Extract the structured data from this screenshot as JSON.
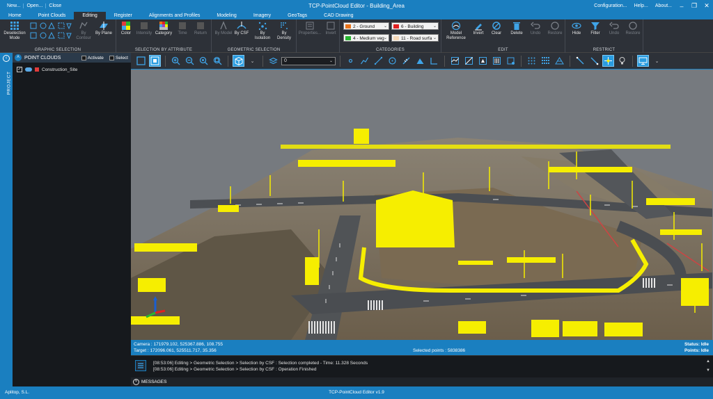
{
  "titlebar": {
    "title": "TCP-PointCloud Editor - Building_Area",
    "quick_access": [
      "New...",
      "Open...",
      "Close"
    ],
    "right_links": [
      "Configuration...",
      "Help...",
      "About..."
    ]
  },
  "tabs": [
    "Home",
    "Point Clouds",
    "Editing",
    "Register",
    "Alignments and Profiles",
    "Modeling",
    "Imagery",
    "GeoTags",
    "CAD Drawing"
  ],
  "active_tab": "Editing",
  "ribbon": {
    "graphic_selection": {
      "label": "GRAPHIC SELECTION",
      "deselection": "Deselection Mode",
      "by_contour": "By Contour",
      "by_plane": "By Plane"
    },
    "selection_by_attribute": {
      "label": "SELECTION BY ATTRIBUTE",
      "color": "Color",
      "intensity": "Intensity",
      "category": "Category",
      "time": "Time",
      "return": "Return"
    },
    "geometric_selection": {
      "label": "GEOMETRIC SELECTION",
      "by_model": "By Model",
      "by_csf": "By CSF",
      "by_isolation": "By Isolation",
      "by_density": "By Density"
    },
    "properties": "Properties...",
    "invert": "Invert",
    "categories": {
      "label": "CATEGORIES",
      "items": [
        {
          "text": "2 - Ground",
          "color": "#e8731a"
        },
        {
          "text": "6 - Building",
          "color": "#e02020"
        },
        {
          "text": "4 - Medium veg",
          "color": "#27b530"
        },
        {
          "text": "11 - Road surfa",
          "color": "#f6d9b8"
        }
      ]
    },
    "edit": {
      "label": "EDIT",
      "model_reference": "Model Reference",
      "invert": "Invert",
      "clear": "Clear",
      "delete": "Delete",
      "undo": "Undo",
      "restore": "Restore"
    },
    "restrict": {
      "label": "RESTRICT",
      "hide": "Hide",
      "filter": "Filter",
      "undo": "Undo",
      "restore": "Restore"
    }
  },
  "project_strip": {
    "label": "PROJECT"
  },
  "panel": {
    "title": "POINT CLOUDS",
    "activate": "Activate",
    "select": "Select",
    "item": "Construction_Site"
  },
  "view_toolbar": {
    "level_value": "0"
  },
  "info": {
    "camera": "Camera : 171979.102, 525367.886, 108.755",
    "target": "Target : 172096.061, 525511.717, 35.356",
    "selected": "Selected points : 5838386",
    "status": "Status: Idle",
    "points": "Points: Idle"
  },
  "messages": {
    "lines": [
      "[08:53:06] Editing > Geometric Selection > Selection by CSF : Selection completed - Time: 11.328 Seconds",
      "[08:53:06] Editing > Geometric Selection > Selection by CSF : Operation Finished"
    ],
    "bar_label": "MESSAGES"
  },
  "status": {
    "company": "Aplitop, S.L.",
    "version": "TCP-PointCloud Editor v1.9"
  },
  "colors": {
    "accent": "#1a7fc0",
    "highlight": "#f6ee00"
  }
}
